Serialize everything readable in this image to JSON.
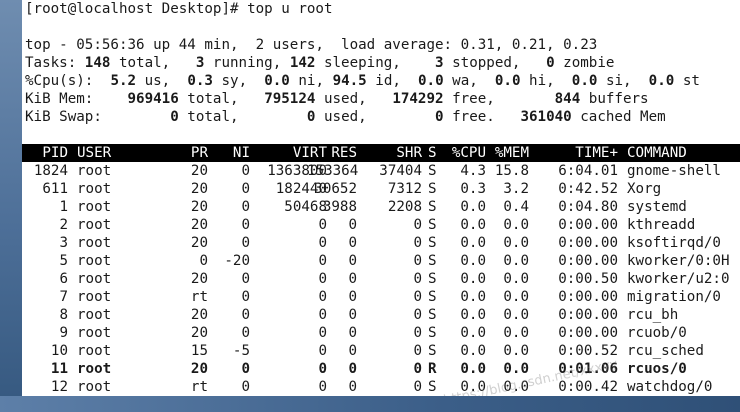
{
  "prompt": "[root@localhost Desktop]# top u root",
  "summary": {
    "uptime": {
      "prefix": "top - 05:56:36 up 44 min,  2 users,  load average: 0.31, 0.21, 0.23"
    },
    "tasks": {
      "label": "Tasks:",
      "total": "148",
      "total_lbl": " total,",
      "running": "3",
      "running_lbl": " running,",
      "sleeping": "142",
      "sleeping_lbl": " sleeping,",
      "stopped": "3",
      "stopped_lbl": " stopped,",
      "zombie": "0",
      "zombie_lbl": " zombie"
    },
    "cpu": {
      "label": "%Cpu(s):",
      "us": "5.2",
      "us_lbl": " us,",
      "sy": "0.3",
      "sy_lbl": " sy,",
      "ni": "0.0",
      "ni_lbl": " ni,",
      "id": "94.5",
      "id_lbl": " id,",
      "wa": "0.0",
      "wa_lbl": " wa,",
      "hi": "0.0",
      "hi_lbl": " hi,",
      "si": "0.0",
      "si_lbl": " si,",
      "st": "0.0",
      "st_lbl": " st"
    },
    "mem": {
      "label": "KiB Mem:",
      "total": "969416",
      "total_lbl": " total,",
      "used": "795124",
      "used_lbl": " used,",
      "free": "174292",
      "free_lbl": " free,",
      "buffers": "844",
      "buffers_lbl": " buffers"
    },
    "swap": {
      "label": "KiB Swap:",
      "total": "0",
      "total_lbl": " total,",
      "used": "0",
      "used_lbl": " used,",
      "free": "0",
      "free_lbl": " free.",
      "cached": "361040",
      "cached_lbl": " cached Mem"
    }
  },
  "table": {
    "headers": {
      "pid": "PID",
      "user": "USER",
      "pr": "PR",
      "ni": "NI",
      "virt": "VIRT",
      "res": "RES",
      "shr": "SHR",
      "s": "S",
      "cpu": "%CPU",
      "mem": "%MEM",
      "time": "TIME+",
      "command": "COMMAND"
    },
    "rows": [
      {
        "pid": "1824",
        "user": "root",
        "pr": "20",
        "ni": "0",
        "virt": "1363800",
        "res": "153364",
        "shr": "37404",
        "s": "S",
        "cpu": "4.3",
        "mem": "15.8",
        "time": "6:04.01",
        "command": "gnome-shell",
        "bold": false
      },
      {
        "pid": "611",
        "user": "root",
        "pr": "20",
        "ni": "0",
        "virt": "182440",
        "res": "30652",
        "shr": "7312",
        "s": "S",
        "cpu": "0.3",
        "mem": "3.2",
        "time": "0:42.52",
        "command": "Xorg",
        "bold": false
      },
      {
        "pid": "1",
        "user": "root",
        "pr": "20",
        "ni": "0",
        "virt": "50468",
        "res": "3988",
        "shr": "2208",
        "s": "S",
        "cpu": "0.0",
        "mem": "0.4",
        "time": "0:04.80",
        "command": "systemd",
        "bold": false
      },
      {
        "pid": "2",
        "user": "root",
        "pr": "20",
        "ni": "0",
        "virt": "0",
        "res": "0",
        "shr": "0",
        "s": "S",
        "cpu": "0.0",
        "mem": "0.0",
        "time": "0:00.00",
        "command": "kthreadd",
        "bold": false
      },
      {
        "pid": "3",
        "user": "root",
        "pr": "20",
        "ni": "0",
        "virt": "0",
        "res": "0",
        "shr": "0",
        "s": "S",
        "cpu": "0.0",
        "mem": "0.0",
        "time": "0:00.00",
        "command": "ksoftirqd/0",
        "bold": false
      },
      {
        "pid": "5",
        "user": "root",
        "pr": "0",
        "ni": "-20",
        "virt": "0",
        "res": "0",
        "shr": "0",
        "s": "S",
        "cpu": "0.0",
        "mem": "0.0",
        "time": "0:00.00",
        "command": "kworker/0:0H",
        "bold": false
      },
      {
        "pid": "6",
        "user": "root",
        "pr": "20",
        "ni": "0",
        "virt": "0",
        "res": "0",
        "shr": "0",
        "s": "S",
        "cpu": "0.0",
        "mem": "0.0",
        "time": "0:00.50",
        "command": "kworker/u2:0",
        "bold": false
      },
      {
        "pid": "7",
        "user": "root",
        "pr": "rt",
        "ni": "0",
        "virt": "0",
        "res": "0",
        "shr": "0",
        "s": "S",
        "cpu": "0.0",
        "mem": "0.0",
        "time": "0:00.00",
        "command": "migration/0",
        "bold": false
      },
      {
        "pid": "8",
        "user": "root",
        "pr": "20",
        "ni": "0",
        "virt": "0",
        "res": "0",
        "shr": "0",
        "s": "S",
        "cpu": "0.0",
        "mem": "0.0",
        "time": "0:00.00",
        "command": "rcu_bh",
        "bold": false
      },
      {
        "pid": "9",
        "user": "root",
        "pr": "20",
        "ni": "0",
        "virt": "0",
        "res": "0",
        "shr": "0",
        "s": "S",
        "cpu": "0.0",
        "mem": "0.0",
        "time": "0:00.00",
        "command": "rcuob/0",
        "bold": false
      },
      {
        "pid": "10",
        "user": "root",
        "pr": "15",
        "ni": "-5",
        "virt": "0",
        "res": "0",
        "shr": "0",
        "s": "S",
        "cpu": "0.0",
        "mem": "0.0",
        "time": "0:00.52",
        "command": "rcu_sched",
        "bold": false
      },
      {
        "pid": "11",
        "user": "root",
        "pr": "20",
        "ni": "0",
        "virt": "0",
        "res": "0",
        "shr": "0",
        "s": "R",
        "cpu": "0.0",
        "mem": "0.0",
        "time": "0:01.06",
        "command": "rcuos/0",
        "bold": true
      },
      {
        "pid": "12",
        "user": "root",
        "pr": "rt",
        "ni": "0",
        "virt": "0",
        "res": "0",
        "shr": "0",
        "s": "S",
        "cpu": "0.0",
        "mem": "0.0",
        "time": "0:00.42",
        "command": "watchdog/0",
        "bold": false
      }
    ]
  },
  "watermark": "https://blog.csdn.net/xxxyy",
  "colors": {
    "terminal_bg": "#ffffff",
    "terminal_fg": "#1a1a1a",
    "header_bg": "#000000",
    "header_fg": "#ffffff",
    "desktop": "#3a5f8c"
  }
}
